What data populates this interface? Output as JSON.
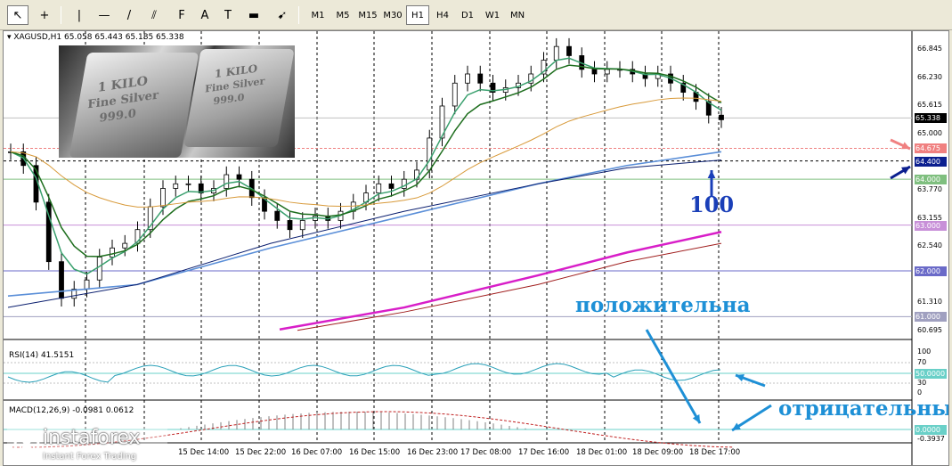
{
  "toolbar": {
    "tools": [
      {
        "name": "cursor-tool",
        "glyph": "↖"
      },
      {
        "name": "crosshair-tool",
        "glyph": "+"
      },
      {
        "name": "vertical-line-tool",
        "glyph": "|"
      },
      {
        "name": "horizontal-line-tool",
        "glyph": "—"
      },
      {
        "name": "trendline-tool",
        "glyph": "/"
      },
      {
        "name": "channel-tool",
        "glyph": "⫽"
      },
      {
        "name": "fibonacci-tool",
        "glyph": "F"
      },
      {
        "name": "text-tool",
        "glyph": "A"
      },
      {
        "name": "text-label-tool",
        "glyph": "T"
      },
      {
        "name": "shape-tool",
        "glyph": "▬"
      },
      {
        "name": "arrow-tool",
        "glyph": "➹"
      }
    ],
    "timeframes": [
      "M1",
      "M5",
      "M15",
      "M30",
      "H1",
      "H4",
      "D1",
      "W1",
      "MN"
    ],
    "active_timeframe": "H1"
  },
  "chart_header": {
    "symbol": "XAGUSD,H1",
    "ohlc": "65.058 65.443 65.185 65.338"
  },
  "photo": {
    "bar1_line1": "1 KILO",
    "bar1_line2": "Fine Silver",
    "bar1_line3": "999.0",
    "bar2_line1": "1 KILO",
    "bar2_line2": "Fine Silver",
    "bar2_line3": "999.0"
  },
  "price_axis": {
    "ticks": [
      "66.845",
      "66.230",
      "65.615",
      "65.000",
      "64.385",
      "63.770",
      "63.155",
      "62.540",
      "61.925",
      "61.310",
      "60.695"
    ],
    "tags": [
      {
        "value": "65.338",
        "color": "#000000",
        "text_color": "#ffffff"
      },
      {
        "value": "64.675",
        "color": "#f08080",
        "text_color": "#ffffff"
      },
      {
        "value": "64.400",
        "color": "#0b1f8f",
        "text_color": "#ffffff"
      },
      {
        "value": "64.000",
        "color": "#7fbf7f",
        "text_color": "#ffffff"
      },
      {
        "value": "63.000",
        "color": "#c890d8",
        "text_color": "#ffffff"
      },
      {
        "value": "62.000",
        "color": "#6a6ac8",
        "text_color": "#ffffff"
      },
      {
        "value": "61.000",
        "color": "#a0a0c0",
        "text_color": "#ffffff"
      }
    ]
  },
  "rsi": {
    "label": "RSI(14) 41.5151",
    "ticks": [
      "100",
      "70",
      "50.0000",
      "30",
      "0"
    ]
  },
  "macd": {
    "label": "MACD(12,26,9) -0.0981 0.0612",
    "ticks": [
      "0.0000",
      "-0.3937"
    ]
  },
  "time_axis": [
    "15 Dec 14:00",
    "15 Dec 22:00",
    "16 Dec 07:00",
    "16 Dec 15:00",
    "16 Dec 23:00",
    "17 Dec 08:00",
    "17 Dec 16:00",
    "18 Dec 01:00",
    "18 Dec 09:00",
    "18 Dec 17:00"
  ],
  "annotations": {
    "level_100": "100",
    "positive": "положительна",
    "negative": "отрицательны"
  },
  "logo": {
    "brand": "instaforex",
    "tagline": "Instant Forex Trading"
  },
  "colors": {
    "ema_fast": "#1e6e1e",
    "ema_slow": "#3aa06e",
    "ma_orange": "#d89a3a",
    "ma_blue": "#5b8fd8",
    "ma_navy": "#0b1f6f",
    "ma_magenta": "#d81ec8",
    "ma_darkred": "#a01e1e",
    "annotation_blue": "#1e90d6"
  }
}
